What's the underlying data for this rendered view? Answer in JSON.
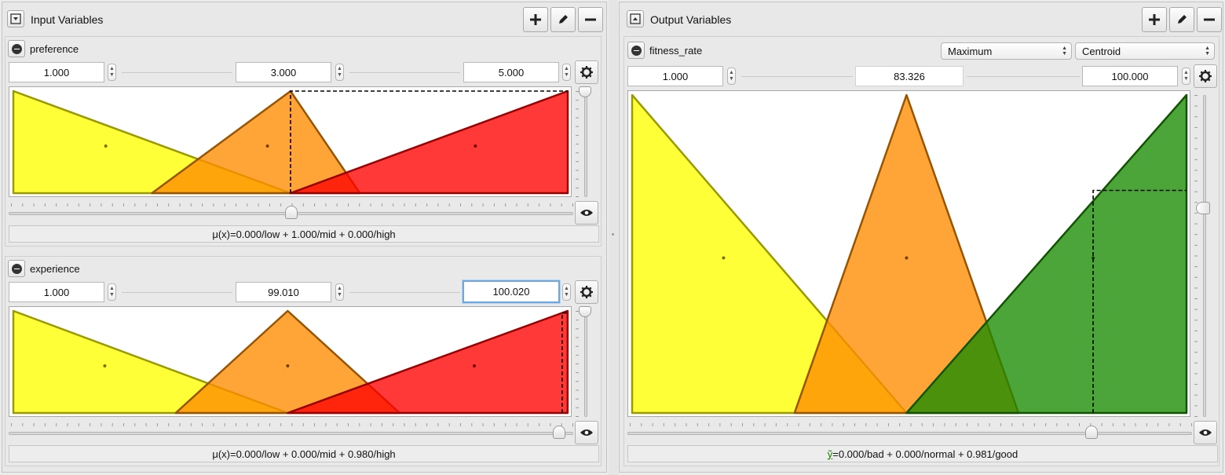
{
  "input_panel": {
    "title": "Input Variables",
    "buttons": {
      "add": "add-icon",
      "edit": "pencil-icon",
      "remove": "minus-icon"
    },
    "variables": [
      {
        "name": "preference",
        "min": "1.000",
        "value": "3.000",
        "max": "5.000",
        "terms": [
          {
            "name": "low",
            "shape": "triangle",
            "points": [
              1.0,
              1.0,
              3.0
            ],
            "color": "#ffff00"
          },
          {
            "name": "mid",
            "shape": "triangle",
            "points": [
              2.0,
              3.0,
              3.5
            ],
            "color": "#ff8c00"
          },
          {
            "name": "high",
            "shape": "triangle",
            "points": [
              3.0,
              5.0,
              5.0
            ],
            "color": "#ff0000"
          }
        ],
        "slider_value": 3.0,
        "result": "μ(x)=0.000/low + 1.000/mid + 0.000/high"
      },
      {
        "name": "experience",
        "min": "1.000",
        "value": "99.010",
        "max": "100.020",
        "terms": [
          {
            "name": "low",
            "shape": "triangle",
            "points": [
              1.0,
              1.0,
              50.0
            ],
            "color": "#ffff00"
          },
          {
            "name": "mid",
            "shape": "triangle",
            "points": [
              30.0,
              50.0,
              70.0
            ],
            "color": "#ff8c00"
          },
          {
            "name": "high",
            "shape": "triangle",
            "points": [
              50.0,
              100.0,
              100.0
            ],
            "color": "#ff0000"
          }
        ],
        "slider_value": 99.01,
        "result": "μ(x)=0.000/low + 0.000/mid + 0.980/high"
      }
    ]
  },
  "output_panel": {
    "title": "Output Variables",
    "buttons": {
      "add": "add-icon",
      "edit": "pencil-icon",
      "remove": "minus-icon"
    },
    "variable": {
      "name": "fitness_rate",
      "accumulation": "Maximum",
      "defuzzifier": "Centroid",
      "min": "1.000",
      "value": "83.326",
      "max": "100.000",
      "terms": [
        {
          "name": "bad",
          "shape": "triangle",
          "points": [
            1.0,
            1.0,
            50.0
          ],
          "color": "#ffff00"
        },
        {
          "name": "normal",
          "shape": "triangle",
          "points": [
            30.0,
            50.0,
            70.0
          ],
          "color": "#ff8c00"
        },
        {
          "name": "good",
          "shape": "triangle",
          "points": [
            50.0,
            100.0,
            100.0
          ],
          "color": "#1a8c00"
        }
      ],
      "slider_value": 83.326,
      "activation": 0.981,
      "result_prefix": "ỹ",
      "result": "=0.000/bad + 0.000/normal + 0.981/good"
    }
  }
}
